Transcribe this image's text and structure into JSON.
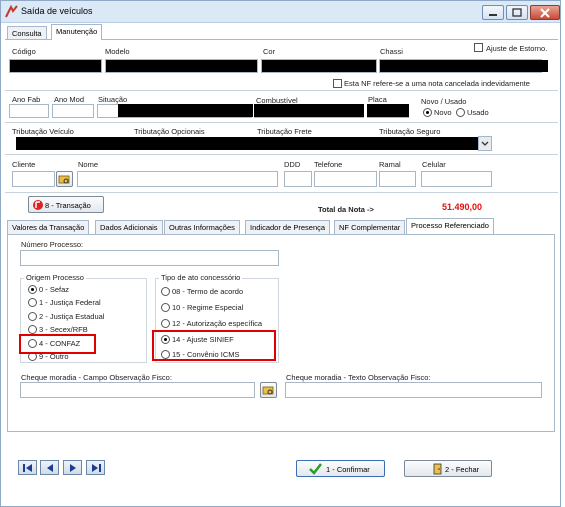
{
  "window": {
    "title": "Saída de veículos"
  },
  "top_tabs": [
    "Consulta",
    "Manutenção"
  ],
  "labels": {
    "codigo": "Código",
    "modelo": "Modelo",
    "cor": "Cor",
    "chassi": "Chassi",
    "ajuste_estorno": "Ajuste de Estorno.",
    "nf_cancelada": "Esta NF refere-se a uma nota cancelada indevidamente",
    "ano_fab": "Ano Fab",
    "ano_mod": "Ano Mod",
    "situacao": "Situação",
    "combustivel": "Combustível",
    "placa": "Placa",
    "novo_usado": "Novo / Usado",
    "novo": "Novo",
    "usado": "Usado",
    "trib_veiculo": "Tributação Veículo",
    "trib_opcionais": "Tributação Opcionais",
    "trib_frete": "Tributação Frete",
    "trib_seguro": "Tributação Seguro",
    "cliente": "Cliente",
    "nome": "Nome",
    "ddd": "DDD",
    "telefone": "Telefone",
    "ramal": "Ramal",
    "celular": "Celular"
  },
  "transacao_button": "8 - Transação",
  "total": {
    "label": "Total da Nota ->",
    "value": "51.490,00"
  },
  "sub_tabs": [
    "Valores da Transação",
    "Dados Adicionais",
    "Outras Informações",
    "Indicador de Presença",
    "NF Complementar",
    "Processo Referenciado"
  ],
  "processo": {
    "numero_label": "Número Processo:",
    "origem_title": "Origem Processo",
    "origem_options": [
      "0 - Sefaz",
      "1 - Justiça Federal",
      "2 - Justiça Estadual",
      "3 - Secex/RFB",
      "4 - CONFAZ",
      "9 - Outro"
    ],
    "tipo_title": "Tipo de ato concessório",
    "tipo_options": [
      "08 - Termo de acordo",
      "10 - Regime Especial",
      "12 - Autorização específica",
      "14 - Ajuste SINIEF",
      "15 - Convênio ICMS"
    ],
    "cheque_campo_label": "Cheque moradia - Campo Observação Fisco:",
    "cheque_texto_label": "Cheque moradia - Texto Observação Fisco:"
  },
  "buttons": {
    "confirmar": "1 - Confirmar",
    "fechar": "2 - Fechar"
  },
  "colors": {
    "total_value": "#e01010",
    "highlight": "#e00000",
    "confirm_check": "#2a9d2a"
  }
}
